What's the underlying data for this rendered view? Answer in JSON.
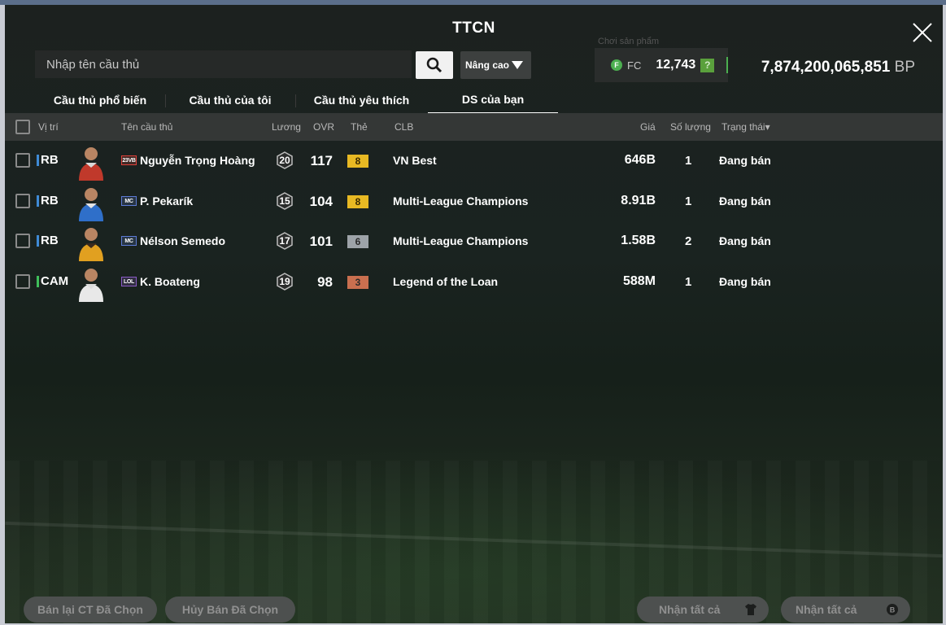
{
  "window": {
    "title": "TTCN",
    "ghost_label": "Chơi sản phẩm"
  },
  "search": {
    "placeholder": "Nhập tên cầu thủ",
    "advanced_label": "Nâng cao"
  },
  "balance": {
    "fc_label": "FC",
    "fc_amount": "12,743",
    "fc_help": "?",
    "bp_amount": "7,874,200,065,851",
    "bp_unit": "BP"
  },
  "tabs": [
    {
      "label": "Cầu thủ phổ biến",
      "active": false
    },
    {
      "label": "Cầu thủ của tôi",
      "active": false
    },
    {
      "label": "Cầu thủ yêu thích",
      "active": false
    },
    {
      "label": "DS của bạn",
      "active": true
    }
  ],
  "table": {
    "headers": {
      "position": "Vị trí",
      "name": "Tên cầu thủ",
      "salary": "Lương",
      "ovr": "OVR",
      "grade": "Thẻ",
      "club": "CLB",
      "price": "Giá",
      "quantity": "Số lượng",
      "status": "Trạng thái▾"
    },
    "rows": [
      {
        "position": "RB",
        "pos_color": "#3f8bd6",
        "season": "23VB",
        "season_color": "#e0413a",
        "name": "Nguyễn Trọng Hoàng",
        "salary": "20",
        "ovr": "117",
        "grade": "8",
        "grade_color": "#e8b923",
        "club": "VN Best",
        "price": "646B",
        "quantity": "1",
        "status": "Đang bán"
      },
      {
        "position": "RB",
        "pos_color": "#3f8bd6",
        "season": "MC",
        "season_color": "#5d7bd6",
        "name": "P. Pekarík",
        "salary": "15",
        "ovr": "104",
        "grade": "8",
        "grade_color": "#e8b923",
        "club": "Multi-League Champions",
        "price": "8.91B",
        "quantity": "1",
        "status": "Đang bán"
      },
      {
        "position": "RB",
        "pos_color": "#3f8bd6",
        "season": "MC",
        "season_color": "#5d7bd6",
        "name": "Nélson Semedo",
        "salary": "17",
        "ovr": "101",
        "grade": "6",
        "grade_color": "#9da3a8",
        "club": "Multi-League Champions",
        "price": "1.58B",
        "quantity": "2",
        "status": "Đang bán"
      },
      {
        "position": "CAM",
        "pos_color": "#3fbf5a",
        "season": "LOL",
        "season_color": "#8b5cc7",
        "name": "K. Boateng",
        "salary": "19",
        "ovr": "98",
        "grade": "3",
        "grade_color": "#c96f4f",
        "club": "Legend of the Loan",
        "price": "588M",
        "quantity": "1",
        "status": "Đang bán"
      }
    ]
  },
  "footer": {
    "resell_label": "Bán lại CT Đã Chọn",
    "cancel_label": "Hủy Bán Đã Chọn",
    "claim_all_label_1": "Nhận tất cả",
    "claim_all_label_2": "Nhận tất cả"
  },
  "icons": {
    "close": "close-icon",
    "search": "search-icon",
    "dropdown": "triangle-down-icon",
    "fc_coin": "fc-coin-icon",
    "shirt": "shirt-icon",
    "coin": "coin-icon"
  }
}
